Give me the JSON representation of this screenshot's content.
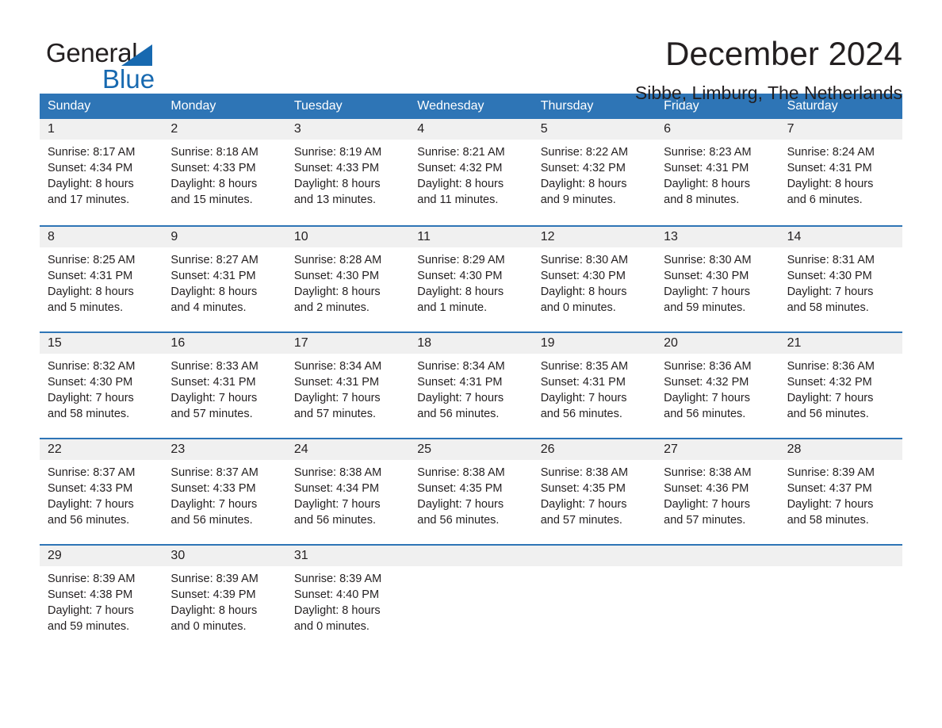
{
  "brand": {
    "name_part1": "General",
    "name_part2": "Blue",
    "accent_color": "#1769b0"
  },
  "header": {
    "title": "December 2024",
    "subtitle": "Sibbe, Limburg, The Netherlands"
  },
  "calendar": {
    "header_color": "#2e75b6",
    "day_band_color": "#f0f0f0",
    "weekdays": [
      "Sunday",
      "Monday",
      "Tuesday",
      "Wednesday",
      "Thursday",
      "Friday",
      "Saturday"
    ],
    "weeks": [
      [
        {
          "day": "1",
          "sunrise": "Sunrise: 8:17 AM",
          "sunset": "Sunset: 4:34 PM",
          "daylight": "Daylight: 8 hours and 17 minutes."
        },
        {
          "day": "2",
          "sunrise": "Sunrise: 8:18 AM",
          "sunset": "Sunset: 4:33 PM",
          "daylight": "Daylight: 8 hours and 15 minutes."
        },
        {
          "day": "3",
          "sunrise": "Sunrise: 8:19 AM",
          "sunset": "Sunset: 4:33 PM",
          "daylight": "Daylight: 8 hours and 13 minutes."
        },
        {
          "day": "4",
          "sunrise": "Sunrise: 8:21 AM",
          "sunset": "Sunset: 4:32 PM",
          "daylight": "Daylight: 8 hours and 11 minutes."
        },
        {
          "day": "5",
          "sunrise": "Sunrise: 8:22 AM",
          "sunset": "Sunset: 4:32 PM",
          "daylight": "Daylight: 8 hours and 9 minutes."
        },
        {
          "day": "6",
          "sunrise": "Sunrise: 8:23 AM",
          "sunset": "Sunset: 4:31 PM",
          "daylight": "Daylight: 8 hours and 8 minutes."
        },
        {
          "day": "7",
          "sunrise": "Sunrise: 8:24 AM",
          "sunset": "Sunset: 4:31 PM",
          "daylight": "Daylight: 8 hours and 6 minutes."
        }
      ],
      [
        {
          "day": "8",
          "sunrise": "Sunrise: 8:25 AM",
          "sunset": "Sunset: 4:31 PM",
          "daylight": "Daylight: 8 hours and 5 minutes."
        },
        {
          "day": "9",
          "sunrise": "Sunrise: 8:27 AM",
          "sunset": "Sunset: 4:31 PM",
          "daylight": "Daylight: 8 hours and 4 minutes."
        },
        {
          "day": "10",
          "sunrise": "Sunrise: 8:28 AM",
          "sunset": "Sunset: 4:30 PM",
          "daylight": "Daylight: 8 hours and 2 minutes."
        },
        {
          "day": "11",
          "sunrise": "Sunrise: 8:29 AM",
          "sunset": "Sunset: 4:30 PM",
          "daylight": "Daylight: 8 hours and 1 minute."
        },
        {
          "day": "12",
          "sunrise": "Sunrise: 8:30 AM",
          "sunset": "Sunset: 4:30 PM",
          "daylight": "Daylight: 8 hours and 0 minutes."
        },
        {
          "day": "13",
          "sunrise": "Sunrise: 8:30 AM",
          "sunset": "Sunset: 4:30 PM",
          "daylight": "Daylight: 7 hours and 59 minutes."
        },
        {
          "day": "14",
          "sunrise": "Sunrise: 8:31 AM",
          "sunset": "Sunset: 4:30 PM",
          "daylight": "Daylight: 7 hours and 58 minutes."
        }
      ],
      [
        {
          "day": "15",
          "sunrise": "Sunrise: 8:32 AM",
          "sunset": "Sunset: 4:30 PM",
          "daylight": "Daylight: 7 hours and 58 minutes."
        },
        {
          "day": "16",
          "sunrise": "Sunrise: 8:33 AM",
          "sunset": "Sunset: 4:31 PM",
          "daylight": "Daylight: 7 hours and 57 minutes."
        },
        {
          "day": "17",
          "sunrise": "Sunrise: 8:34 AM",
          "sunset": "Sunset: 4:31 PM",
          "daylight": "Daylight: 7 hours and 57 minutes."
        },
        {
          "day": "18",
          "sunrise": "Sunrise: 8:34 AM",
          "sunset": "Sunset: 4:31 PM",
          "daylight": "Daylight: 7 hours and 56 minutes."
        },
        {
          "day": "19",
          "sunrise": "Sunrise: 8:35 AM",
          "sunset": "Sunset: 4:31 PM",
          "daylight": "Daylight: 7 hours and 56 minutes."
        },
        {
          "day": "20",
          "sunrise": "Sunrise: 8:36 AM",
          "sunset": "Sunset: 4:32 PM",
          "daylight": "Daylight: 7 hours and 56 minutes."
        },
        {
          "day": "21",
          "sunrise": "Sunrise: 8:36 AM",
          "sunset": "Sunset: 4:32 PM",
          "daylight": "Daylight: 7 hours and 56 minutes."
        }
      ],
      [
        {
          "day": "22",
          "sunrise": "Sunrise: 8:37 AM",
          "sunset": "Sunset: 4:33 PM",
          "daylight": "Daylight: 7 hours and 56 minutes."
        },
        {
          "day": "23",
          "sunrise": "Sunrise: 8:37 AM",
          "sunset": "Sunset: 4:33 PM",
          "daylight": "Daylight: 7 hours and 56 minutes."
        },
        {
          "day": "24",
          "sunrise": "Sunrise: 8:38 AM",
          "sunset": "Sunset: 4:34 PM",
          "daylight": "Daylight: 7 hours and 56 minutes."
        },
        {
          "day": "25",
          "sunrise": "Sunrise: 8:38 AM",
          "sunset": "Sunset: 4:35 PM",
          "daylight": "Daylight: 7 hours and 56 minutes."
        },
        {
          "day": "26",
          "sunrise": "Sunrise: 8:38 AM",
          "sunset": "Sunset: 4:35 PM",
          "daylight": "Daylight: 7 hours and 57 minutes."
        },
        {
          "day": "27",
          "sunrise": "Sunrise: 8:38 AM",
          "sunset": "Sunset: 4:36 PM",
          "daylight": "Daylight: 7 hours and 57 minutes."
        },
        {
          "day": "28",
          "sunrise": "Sunrise: 8:39 AM",
          "sunset": "Sunset: 4:37 PM",
          "daylight": "Daylight: 7 hours and 58 minutes."
        }
      ],
      [
        {
          "day": "29",
          "sunrise": "Sunrise: 8:39 AM",
          "sunset": "Sunset: 4:38 PM",
          "daylight": "Daylight: 7 hours and 59 minutes."
        },
        {
          "day": "30",
          "sunrise": "Sunrise: 8:39 AM",
          "sunset": "Sunset: 4:39 PM",
          "daylight": "Daylight: 8 hours and 0 minutes."
        },
        {
          "day": "31",
          "sunrise": "Sunrise: 8:39 AM",
          "sunset": "Sunset: 4:40 PM",
          "daylight": "Daylight: 8 hours and 0 minutes."
        },
        {
          "day": "",
          "sunrise": "",
          "sunset": "",
          "daylight": ""
        },
        {
          "day": "",
          "sunrise": "",
          "sunset": "",
          "daylight": ""
        },
        {
          "day": "",
          "sunrise": "",
          "sunset": "",
          "daylight": ""
        },
        {
          "day": "",
          "sunrise": "",
          "sunset": "",
          "daylight": ""
        }
      ]
    ]
  }
}
